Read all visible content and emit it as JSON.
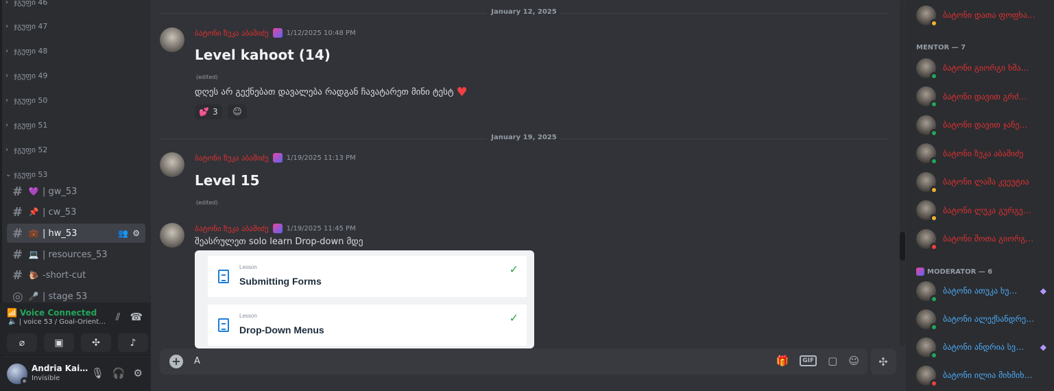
{
  "sidebar": {
    "categories": [
      {
        "label": "ჯგუფი 46",
        "chev": "›"
      },
      {
        "label": "ჯგუფი 47",
        "chev": "›"
      },
      {
        "label": "ჯგუფი 48",
        "chev": "›"
      },
      {
        "label": "ჯგუფი 49",
        "chev": "›"
      },
      {
        "label": "ჯგუფი 50",
        "chev": "›"
      },
      {
        "label": "ჯგუფი 51",
        "chev": "›"
      },
      {
        "label": "ჯგუფი 52",
        "chev": "›"
      },
      {
        "label": "ჯგუფი 53",
        "chev": "⌄"
      }
    ],
    "channels": [
      {
        "hash": "#",
        "emoji": "💜",
        "label": "| gw_53"
      },
      {
        "hash": "#",
        "emoji": "📌",
        "label": "| cw_53"
      },
      {
        "hash": "#",
        "emoji": "💼",
        "label": "| hw_53"
      },
      {
        "hash": "#",
        "emoji": "💻",
        "label": "| resources_53"
      },
      {
        "hash": "#",
        "emoji": "🐌",
        "label": "-short-cut"
      },
      {
        "hash": "◎",
        "emoji": "🎤",
        "label": "| stage 53"
      }
    ],
    "voice": {
      "title": "Voice Connected",
      "subtitle": "| voice 53 / Goal-Orient…"
    },
    "user": {
      "name": "Andria Kai…",
      "status": "Invisible"
    }
  },
  "chat": {
    "dividers": [
      "January 12, 2025",
      "January 19, 2025"
    ],
    "messages": [
      {
        "author": "ბატონი ზუკა აბაშიძე",
        "time": "1/12/2025 10:48 PM",
        "heading": "Level kahoot (14)",
        "edited": "(edited)",
        "body": "დღეს არ გექნებათ დავალება რადგან ჩავატარეთ მინი ტესტ",
        "reaction_emoji": "💕",
        "reaction_count": "3"
      },
      {
        "author": "ბატონი ზუკა აბაშიძე",
        "time": "1/19/2025 11:13 PM",
        "heading": "Level 15",
        "edited": "(edited)"
      },
      {
        "author": "ბატონი ზუკა აბაშიძე",
        "time": "1/19/2025 11:45 PM",
        "body": "შეასრულეთ solo learn Drop-down მდე"
      }
    ],
    "embed_lessons": [
      {
        "label": "Lesson",
        "title": "Submitting Forms"
      },
      {
        "label": "Lesson",
        "title": "Drop-Down Menus"
      }
    ],
    "composer": {
      "value": "A",
      "gif": "GIF"
    }
  },
  "members": {
    "top_member": "ბატონი დათა ფოფხა…",
    "mentor_header": "MENTOR — 7",
    "mentors": [
      {
        "name": "ბატონი გიორგი ხმა…",
        "status": "#23a55a"
      },
      {
        "name": "ბატონი დავით გრძ…",
        "status": "#23a55a"
      },
      {
        "name": "ბატონი დავით ჯანე…",
        "status": "#23a55a"
      },
      {
        "name": "ბატონი ზუკა აბაშიძე",
        "status": "#23a55a"
      },
      {
        "name": "ბატონი ლაშა კვეუტია",
        "status": "#f0b232"
      },
      {
        "name": "ბატონი ლუკა გურგე…",
        "status": "#f0b232"
      },
      {
        "name": "ბატონი შოთა გიორგ…",
        "status": "#f23f43"
      }
    ],
    "moderator_header": "MODERATOR — 6",
    "moderators": [
      {
        "name": "ბატონი ათუკა ხუ…",
        "status": "#23a55a",
        "gem": "◆"
      },
      {
        "name": "ბატონი ალექსანდრე…",
        "status": "#23a55a",
        "gem": ""
      },
      {
        "name": "ბატონი ანდრია სვ…",
        "status": "#23a55a",
        "gem": "◆"
      },
      {
        "name": "ბატონი ილია მიხმიხ…",
        "status": "#f23f43",
        "gem": ""
      }
    ]
  },
  "colors": {
    "mentor_name": "#e03131",
    "moderator_name": "#4dabf7",
    "voice_green": "#23a55a"
  }
}
